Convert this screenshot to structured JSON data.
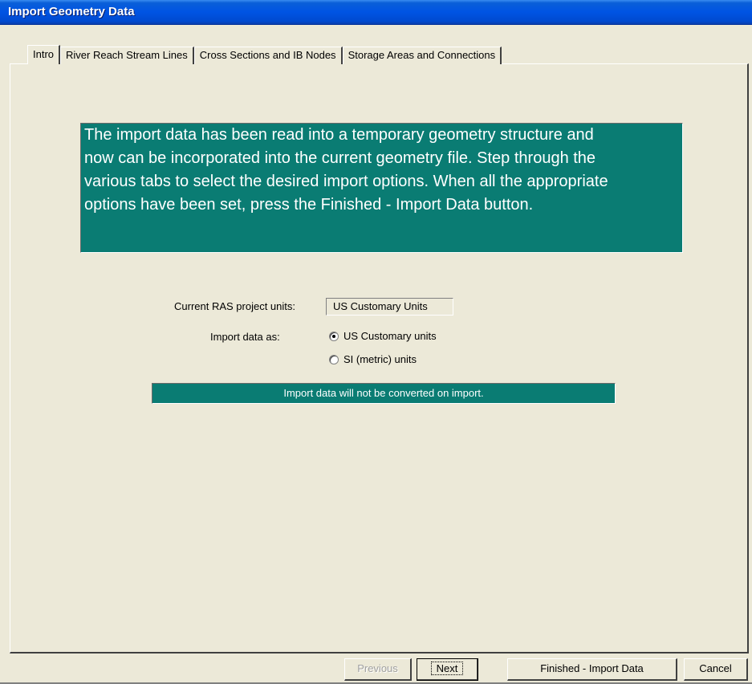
{
  "window": {
    "title": "Import Geometry Data"
  },
  "tabs": [
    {
      "label": "Intro"
    },
    {
      "label": "River Reach Stream Lines"
    },
    {
      "label": "Cross Sections and IB Nodes"
    },
    {
      "label": "Storage Areas and Connections"
    }
  ],
  "active_tab": "Intro",
  "intro": {
    "lines": [
      "The import data has been read into a temporary geometry structure and",
      "now can be incorporated into the current geometry file.  Step through the",
      "various tabs to select the desired import options.  When all the appropriate",
      "options have been set, press the Finished - Import Data button."
    ]
  },
  "units": {
    "current_label": "Current RAS project units:",
    "current_value": "US Customary Units",
    "import_label": "Import data as:",
    "options": [
      {
        "label": "US Customary units",
        "selected": true
      },
      {
        "label": "SI (metric) units",
        "selected": false
      }
    ]
  },
  "status_message": "Import data will not be converted on import.",
  "buttons": {
    "previous": "Previous",
    "next": "Next",
    "finished": "Finished - Import Data",
    "cancel": "Cancel"
  },
  "colors": {
    "accent": "#0a7c73",
    "titlebar": "#0054e3",
    "face": "#ece9d8"
  }
}
